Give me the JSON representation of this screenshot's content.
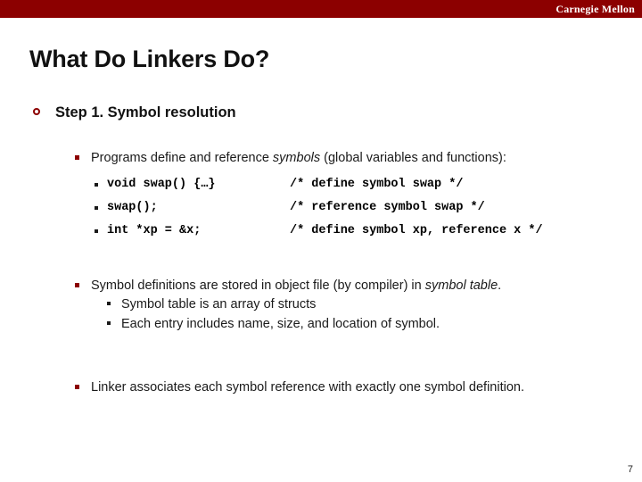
{
  "banner": {
    "brand": "Carnegie Mellon",
    "color": "#8c0000"
  },
  "title": "What Do Linkers Do?",
  "content": {
    "step": "Step 1. Symbol resolution",
    "intro": {
      "before": "Programs define and reference ",
      "italic": "symbols",
      "after": " (global variables and functions):"
    },
    "code_lines": [
      {
        "stmt": "void swap() {…}",
        "comment": "/* define symbol swap */"
      },
      {
        "stmt": "swap();",
        "comment": "/* reference symbol swap */"
      },
      {
        "stmt": "int *xp = &x;",
        "comment": "/* define symbol xp, reference x */"
      }
    ],
    "defs": {
      "before": "Symbol definitions are stored in object file (by compiler) in ",
      "italic": "symbol table",
      "after": "."
    },
    "defs_sub": [
      "Symbol table is an array of structs",
      "Each entry includes name, size, and location of symbol."
    ],
    "linker": "Linker associates each symbol reference with exactly one symbol definition."
  },
  "footer": {
    "page_number": "7"
  }
}
